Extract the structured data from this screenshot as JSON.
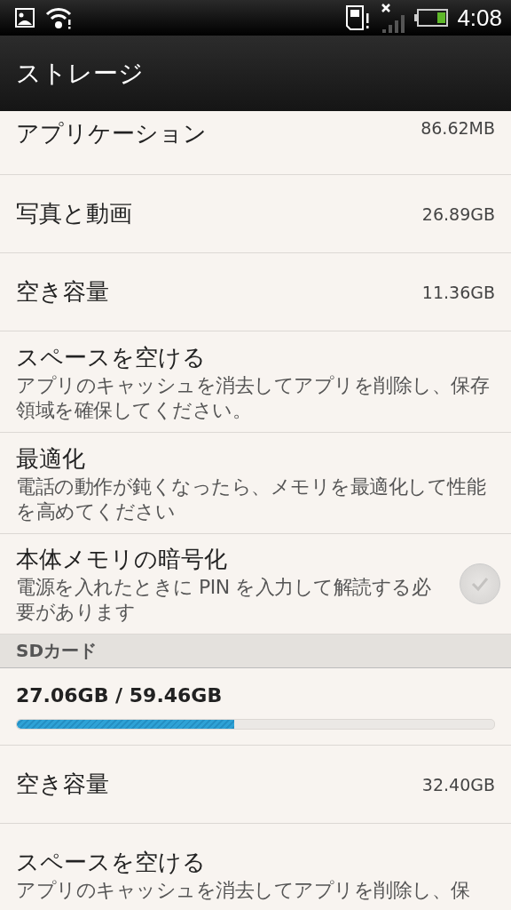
{
  "status_bar": {
    "time": "4:08"
  },
  "title_bar": {
    "title": "ストレージ"
  },
  "items": [
    {
      "kind": "value",
      "label": "アプリケーション",
      "value": "86.62MB"
    },
    {
      "kind": "value",
      "label": "写真と動画",
      "value": "26.89GB"
    },
    {
      "kind": "value",
      "label": "空き容量",
      "value": "11.36GB"
    },
    {
      "kind": "summary",
      "label": "スペースを空ける",
      "summary": "アプリのキャッシュを消去してアプリを削除し、保存領域を確保してください。"
    },
    {
      "kind": "summary",
      "label": "最適化",
      "summary": "電話の動作が鈍くなったら、メモリを最適化して性能を高めてください"
    },
    {
      "kind": "checkbox",
      "label": "本体メモリの暗号化",
      "summary": "電源を入れたときに PIN を入力して解読する必要があります",
      "checked": false
    },
    {
      "kind": "header",
      "label": "SDカード"
    },
    {
      "kind": "progress",
      "label": "27.06GB / 59.46GB",
      "level": 0.455
    },
    {
      "kind": "value",
      "label": "空き容量",
      "value": "32.40GB"
    },
    {
      "kind": "summary",
      "label": "スペースを空ける",
      "summary": "アプリのキャッシュを消去してアプリを削除し、保"
    }
  ]
}
